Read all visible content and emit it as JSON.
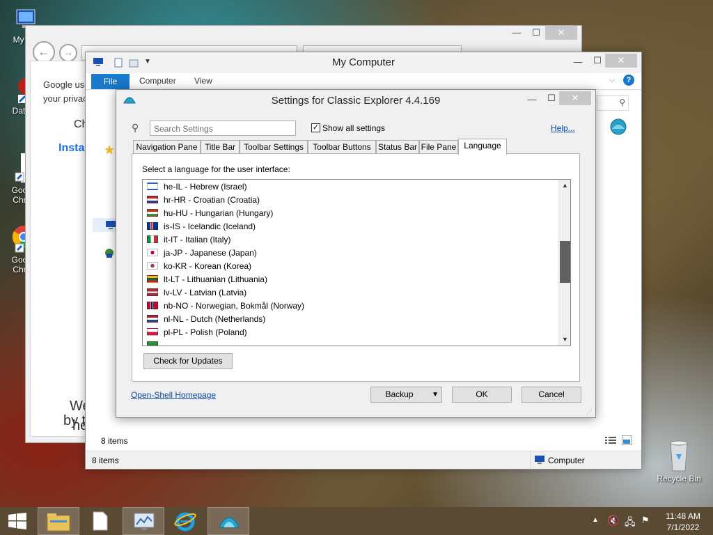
{
  "desktop": {
    "icons": [
      {
        "label": "My Co",
        "name": "my-computer"
      },
      {
        "label": "DataW",
        "name": "dataw"
      },
      {
        "label": "Goo",
        "label2": "Chr",
        "name": "google-chrome-1"
      },
      {
        "label": "Goo",
        "label2": "Chr",
        "name": "google-chrome-2"
      },
      {
        "label": "Recycle Bin",
        "name": "recycle-bin"
      }
    ]
  },
  "browser": {
    "page_text": {
      "line1": "Google use",
      "line2": "your privac",
      "line3": "Ch",
      "line4": "Insta",
      "line5": "We",
      "line6": "he",
      "line7": "by t"
    }
  },
  "mycomputer": {
    "title": "My Computer",
    "ribbon_tabs": [
      "File",
      "Computer",
      "View"
    ],
    "items_count": "8 items",
    "status_items": "8 items",
    "status_location": "Computer"
  },
  "dialog": {
    "title": "Settings for Classic Explorer 4.4.169",
    "search_placeholder": "Search Settings",
    "show_all_label": "Show all settings",
    "show_all_checked": true,
    "help_link": "Help...",
    "tabs": [
      "Navigation Pane",
      "Title Bar",
      "Toolbar Settings",
      "Toolbar Buttons",
      "Status Bar",
      "File Pane",
      "Language"
    ],
    "active_tab": "Language",
    "prompt": "Select a language for the user interface:",
    "languages": [
      {
        "label": "he-IL - Hebrew (Israel)",
        "flag": "il"
      },
      {
        "label": "hr-HR - Croatian (Croatia)",
        "flag": "hr"
      },
      {
        "label": "hu-HU - Hungarian (Hungary)",
        "flag": "hu"
      },
      {
        "label": "is-IS - Icelandic (Iceland)",
        "flag": "is"
      },
      {
        "label": "it-IT - Italian (Italy)",
        "flag": "it"
      },
      {
        "label": "ja-JP - Japanese (Japan)",
        "flag": "jp"
      },
      {
        "label": "ko-KR - Korean (Korea)",
        "flag": "kr"
      },
      {
        "label": "lt-LT - Lithuanian (Lithuania)",
        "flag": "lt"
      },
      {
        "label": "lv-LV - Latvian (Latvia)",
        "flag": "lv"
      },
      {
        "label": "nb-NO - Norwegian, Bokmål (Norway)",
        "flag": "no"
      },
      {
        "label": "nl-NL - Dutch (Netherlands)",
        "flag": "nl"
      },
      {
        "label": "pl-PL - Polish (Poland)",
        "flag": "pl"
      }
    ],
    "check_updates_label": "Check for Updates",
    "homepage_link": "Open-Shell Homepage",
    "backup_label": "Backup",
    "ok_label": "OK",
    "cancel_label": "Cancel"
  },
  "taskbar": {
    "time": "11:48 AM",
    "date": "7/1/2022"
  },
  "colors": {
    "accent": "#1979ca",
    "link": "#0645ad",
    "taskbar": "#5b4a33"
  }
}
